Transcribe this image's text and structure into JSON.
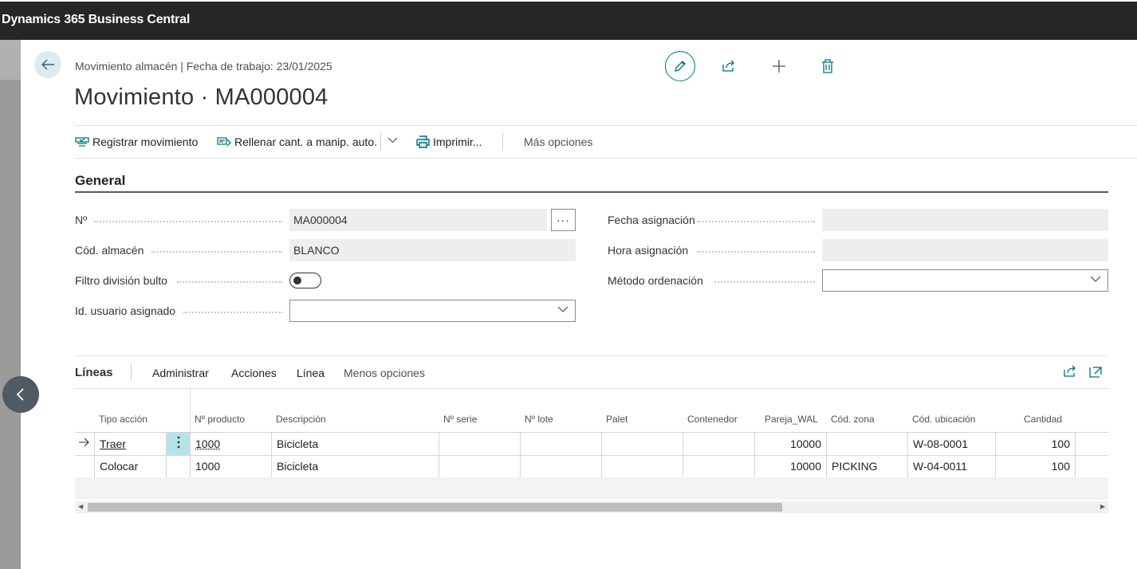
{
  "topbar": {
    "title": "Dynamics 365 Business Central"
  },
  "header": {
    "breadcrumb": "Movimiento almacén | Fecha de trabajo: 23/01/2025",
    "title": "Movimiento · MA000004"
  },
  "actions": {
    "register": "Registrar movimiento",
    "autofill": "Rellenar cant. a manip. auto.",
    "print": "Imprimir...",
    "more": "Más opciones"
  },
  "general": {
    "title": "General",
    "fields": {
      "no_label": "Nº",
      "no_value": "MA000004",
      "ellipsis": "···",
      "warehouse_label": "Cód. almacén",
      "warehouse_value": "BLANCO",
      "filter_label": "Filtro división bulto",
      "user_label": "Id. usuario asignado",
      "user_value": "",
      "assign_date_label": "Fecha asignación",
      "assign_date_value": "",
      "assign_time_label": "Hora asignación",
      "assign_time_value": "",
      "sort_label": "Método ordenación",
      "sort_value": ""
    }
  },
  "lines": {
    "title": "Líneas",
    "menu": [
      "Administrar",
      "Acciones",
      "Línea",
      "Menos opciones"
    ],
    "columns": [
      "Tipo acción",
      "Nº producto",
      "Descripción",
      "Nº serie",
      "Nº lote",
      "Palet",
      "Contenedor",
      "Pareja_WAL",
      "Cód. zona",
      "Cód. ubicación",
      "Cantidad"
    ],
    "rows": [
      {
        "tipo": "Traer",
        "producto": "1000",
        "descripcion": "Bicicleta",
        "serie": "",
        "lote": "",
        "palet": "",
        "contenedor": "",
        "pareja": "10000",
        "zona": "",
        "ubicacion": "W-08-0001",
        "cantidad": "100"
      },
      {
        "tipo": "Colocar",
        "producto": "1000",
        "descripcion": "Bicicleta",
        "serie": "",
        "lote": "",
        "palet": "",
        "contenedor": "",
        "pareja": "10000",
        "zona": "PICKING",
        "ubicacion": "W-04-0011",
        "cantidad": "100"
      }
    ]
  },
  "colors": {
    "accent": "#00737c",
    "topbar": "#262626"
  }
}
